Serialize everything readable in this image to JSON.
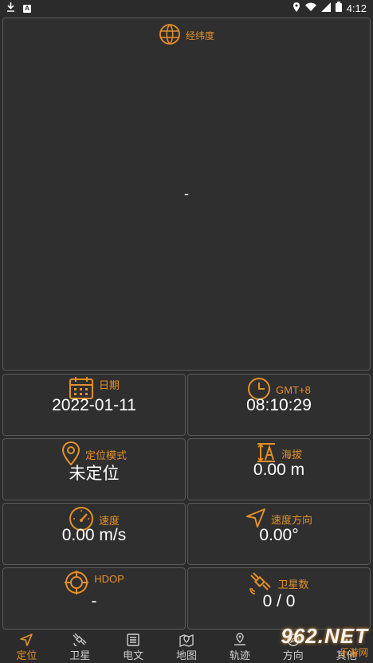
{
  "status": {
    "time": "4:12",
    "left_box": "A"
  },
  "latlon_card": {
    "header": "经纬度",
    "value": "-"
  },
  "cards": {
    "date": {
      "header": "日期",
      "value": "2022-01-11"
    },
    "time": {
      "header": "GMT+8",
      "value": "08:10:29"
    },
    "mode": {
      "header": "定位模式",
      "value": "未定位"
    },
    "altitude": {
      "header": "海拔",
      "value": "0.00 m"
    },
    "speed": {
      "header": "速度",
      "value": "0.00 m/s"
    },
    "heading": {
      "header": "速度方向",
      "value": "0.00°"
    },
    "hdop": {
      "header": "HDOP",
      "value": "-"
    },
    "satellites": {
      "header": "卫星数",
      "value": "0 / 0"
    }
  },
  "tabs": [
    {
      "label": "定位",
      "icon": "navigation-arrow-icon",
      "active": true
    },
    {
      "label": "卫星",
      "icon": "satellite-icon",
      "active": false
    },
    {
      "label": "电文",
      "icon": "message-list-icon",
      "active": false
    },
    {
      "label": "地图",
      "icon": "map-pin-icon",
      "active": false
    },
    {
      "label": "轨迹",
      "icon": "location-track-icon",
      "active": false
    },
    {
      "label": "方向",
      "icon": "compass-icon",
      "active": false
    },
    {
      "label": "其他",
      "icon": "more-icon",
      "active": false
    }
  ],
  "watermark": {
    "top": "962.NET",
    "bottom": "乐游网"
  },
  "colors": {
    "accent": "#e39028",
    "background": "#2b2b2b",
    "card_border": "#5a5a5a"
  }
}
